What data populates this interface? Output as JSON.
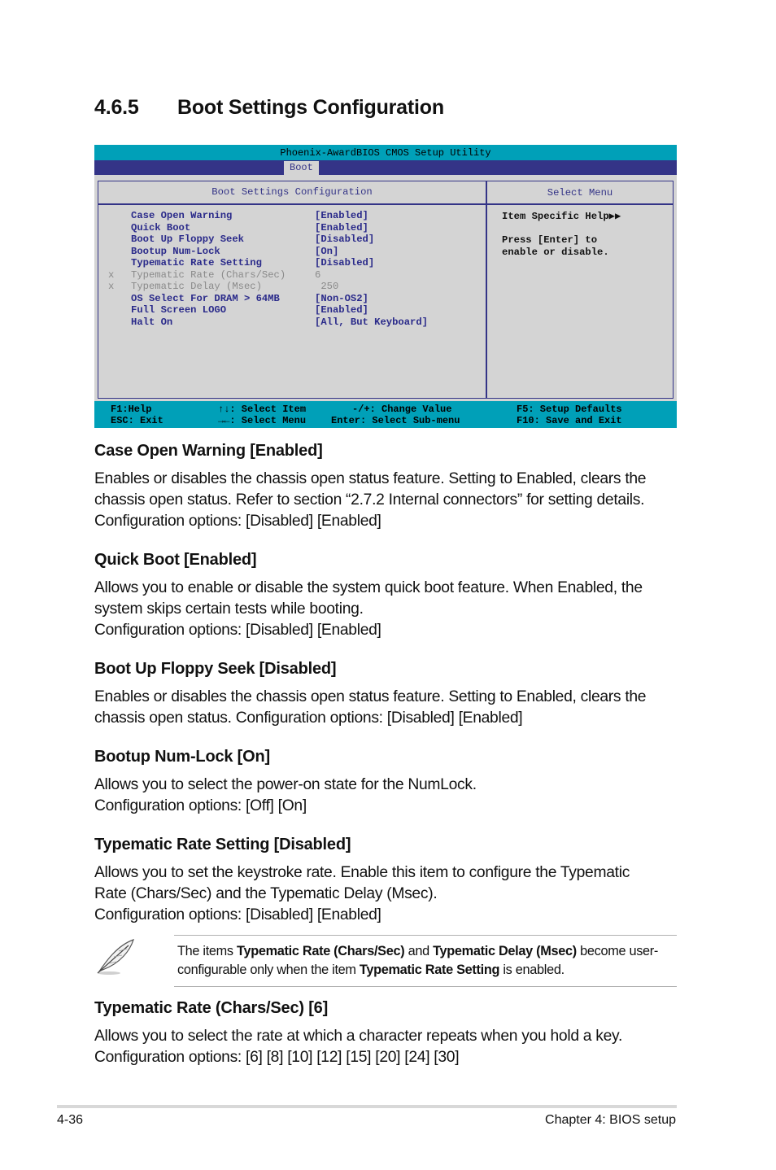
{
  "section": {
    "number": "4.6.5",
    "title": "Boot Settings Configuration"
  },
  "bios": {
    "app_title": "Phoenix-AwardBIOS CMOS Setup Utility",
    "active_tab": "Boot",
    "panel_title": "Boot Settings Configuration",
    "help_title": "Select Menu",
    "items": [
      {
        "marker": "",
        "label": "Case Open Warning",
        "value": "[Enabled]",
        "disabled": false
      },
      {
        "marker": "",
        "label": "Quick Boot",
        "value": "[Enabled]",
        "disabled": false
      },
      {
        "marker": "",
        "label": "Boot Up Floppy Seek",
        "value": "[Disabled]",
        "disabled": false
      },
      {
        "marker": "",
        "label": "Bootup Num-Lock",
        "value": "[On]",
        "disabled": false
      },
      {
        "marker": "",
        "label": "Typematic Rate Setting",
        "value": "[Disabled]",
        "disabled": false
      },
      {
        "marker": "x",
        "label": "Typematic Rate (Chars/Sec)",
        "value": "6",
        "disabled": true
      },
      {
        "marker": "x",
        "label": "Typematic Delay (Msec)",
        "value": " 250",
        "disabled": true
      },
      {
        "marker": "",
        "label": "OS Select For DRAM > 64MB",
        "value": "[Non-OS2]",
        "disabled": false
      },
      {
        "marker": "",
        "label": "Full Screen LOGO",
        "value": "[Enabled]",
        "disabled": false
      },
      {
        "marker": "",
        "label": "Halt On",
        "value": "[All, But Keyboard]",
        "disabled": false
      }
    ],
    "help": {
      "heading": "Item Specific Help▶▶",
      "line1": "Press [Enter] to",
      "line2": "enable or disable."
    },
    "footer": {
      "col1": [
        "F1:Help",
        "ESC: Exit"
      ],
      "col2": [
        "↑↓: Select Item",
        "→←: Select Menu"
      ],
      "col3": [
        "-/+: Change Value",
        "Enter: Select Sub-menu"
      ],
      "col4": [
        "F5: Setup Defaults",
        "F10: Save and Exit"
      ]
    }
  },
  "docs": [
    {
      "heading": "Case Open Warning [Enabled]",
      "lines": [
        "Enables or disables the chassis open status feature. Setting to Enabled, clears the",
        "chassis open status. Refer to section “2.7.2 Internal connectors” for setting details.",
        "Configuration options: [Disabled] [Enabled]"
      ]
    },
    {
      "heading": "Quick Boot [Enabled]",
      "lines": [
        "Allows you to enable or disable the system quick boot feature. When Enabled, the",
        "system skips certain tests while booting.",
        "Configuration options: [Disabled] [Enabled]"
      ]
    },
    {
      "heading": "Boot Up Floppy Seek [Disabled]",
      "lines": [
        "Enables or disables the chassis open status feature. Setting to Enabled, clears the",
        "chassis open status. Configuration options: [Disabled] [Enabled]"
      ]
    },
    {
      "heading": "Bootup Num-Lock [On]",
      "lines": [
        "Allows you to select the power-on state for the NumLock.",
        "Configuration options: [Off] [On]"
      ]
    },
    {
      "heading": "Typematic Rate Setting [Disabled]",
      "lines": [
        "Allows you to set the keystroke rate. Enable this item to configure the Typematic",
        "Rate (Chars/Sec) and the Typematic Delay (Msec).",
        "Configuration options: [Disabled] [Enabled]"
      ]
    },
    {
      "heading": "Typematic Rate (Chars/Sec) [6]",
      "lines": [
        "Allows you to select the rate at which a character repeats when you hold a key.",
        "Configuration options: [6] [8] [10] [12] [15] [20] [24] [30]"
      ]
    }
  ],
  "note": {
    "icon": "feather-pen-icon",
    "t1": "The items ",
    "b1": "Typematic Rate (Chars/Sec)",
    "t2": " and ",
    "b2": "Typematic Delay (Msec)",
    "t3": " become user-configurable only when the item ",
    "b3": "Typematic Rate Setting",
    "t4": " is enabled."
  },
  "footer": {
    "page": "4-36",
    "chapter": "Chapter 4: BIOS setup"
  }
}
